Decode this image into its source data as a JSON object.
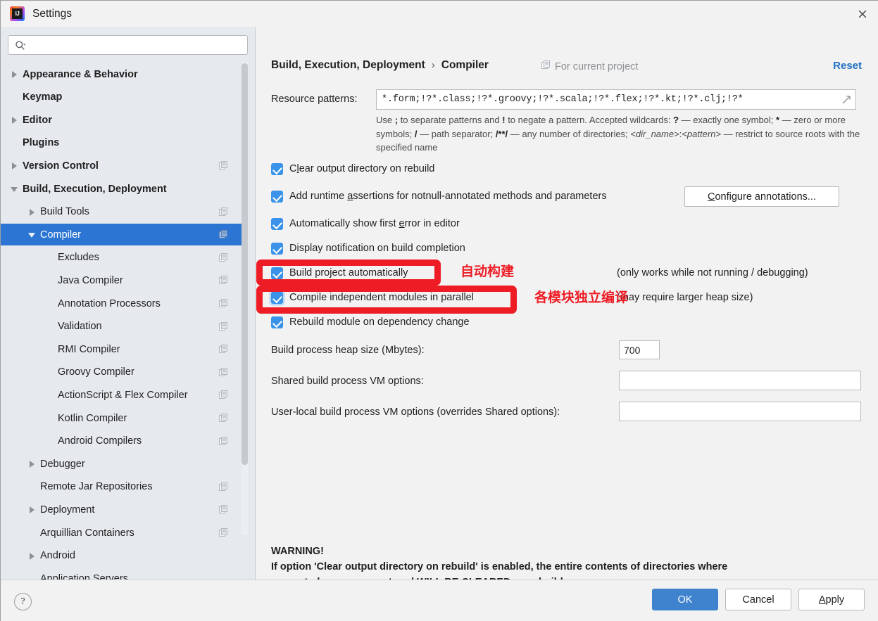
{
  "window": {
    "title": "Settings",
    "logo_icon": "intellij-idea-logo",
    "close_icon": "close-icon"
  },
  "sidebar": {
    "search": {
      "placeholder": "",
      "value": "",
      "icon": "search-icon"
    },
    "items": [
      {
        "label": "Appearance & Behavior",
        "indent": 0,
        "twisty": "closed",
        "bold": true,
        "project": false,
        "selected": false
      },
      {
        "label": "Keymap",
        "indent": 0,
        "twisty": "none",
        "bold": true,
        "project": false,
        "selected": false
      },
      {
        "label": "Editor",
        "indent": 0,
        "twisty": "closed",
        "bold": true,
        "project": false,
        "selected": false
      },
      {
        "label": "Plugins",
        "indent": 0,
        "twisty": "none",
        "bold": true,
        "project": false,
        "selected": false
      },
      {
        "label": "Version Control",
        "indent": 0,
        "twisty": "closed",
        "bold": true,
        "project": true,
        "selected": false
      },
      {
        "label": "Build, Execution, Deployment",
        "indent": 0,
        "twisty": "open",
        "bold": true,
        "project": false,
        "selected": false
      },
      {
        "label": "Build Tools",
        "indent": 1,
        "twisty": "closed",
        "bold": false,
        "project": true,
        "selected": false
      },
      {
        "label": "Compiler",
        "indent": 1,
        "twisty": "open",
        "bold": false,
        "project": true,
        "selected": true
      },
      {
        "label": "Excludes",
        "indent": 2,
        "twisty": "none",
        "bold": false,
        "project": true,
        "selected": false
      },
      {
        "label": "Java Compiler",
        "indent": 2,
        "twisty": "none",
        "bold": false,
        "project": true,
        "selected": false
      },
      {
        "label": "Annotation Processors",
        "indent": 2,
        "twisty": "none",
        "bold": false,
        "project": true,
        "selected": false
      },
      {
        "label": "Validation",
        "indent": 2,
        "twisty": "none",
        "bold": false,
        "project": true,
        "selected": false
      },
      {
        "label": "RMI Compiler",
        "indent": 2,
        "twisty": "none",
        "bold": false,
        "project": true,
        "selected": false
      },
      {
        "label": "Groovy Compiler",
        "indent": 2,
        "twisty": "none",
        "bold": false,
        "project": true,
        "selected": false
      },
      {
        "label": "ActionScript & Flex Compiler",
        "indent": 2,
        "twisty": "none",
        "bold": false,
        "project": true,
        "selected": false
      },
      {
        "label": "Kotlin Compiler",
        "indent": 2,
        "twisty": "none",
        "bold": false,
        "project": true,
        "selected": false
      },
      {
        "label": "Android Compilers",
        "indent": 2,
        "twisty": "none",
        "bold": false,
        "project": true,
        "selected": false
      },
      {
        "label": "Debugger",
        "indent": 1,
        "twisty": "closed",
        "bold": false,
        "project": false,
        "selected": false
      },
      {
        "label": "Remote Jar Repositories",
        "indent": 1,
        "twisty": "none",
        "bold": false,
        "project": true,
        "selected": false
      },
      {
        "label": "Deployment",
        "indent": 1,
        "twisty": "closed",
        "bold": false,
        "project": true,
        "selected": false
      },
      {
        "label": "Arquillian Containers",
        "indent": 1,
        "twisty": "none",
        "bold": false,
        "project": true,
        "selected": false
      },
      {
        "label": "Android",
        "indent": 1,
        "twisty": "closed",
        "bold": false,
        "project": false,
        "selected": false
      },
      {
        "label": "Application Servers",
        "indent": 1,
        "twisty": "none",
        "bold": false,
        "project": false,
        "selected": false
      }
    ]
  },
  "main": {
    "breadcrumb_root": "Build, Execution, Deployment",
    "breadcrumb_sep": "›",
    "breadcrumb_leaf": "Compiler",
    "for_current_project": "For current project",
    "for_current_project_icon": "project-scope-icon",
    "reset_label": "Reset",
    "resource_patterns": {
      "label": "Resource patterns:",
      "value": "*.form;!?*.class;!?*.groovy;!?*.scala;!?*.flex;!?*.kt;!?*.clj;!?*",
      "expand_icon": "expand-field-icon"
    },
    "resource_help": "Use ; to separate patterns and ! to negate a pattern. Accepted wildcards: ? — exactly one symbol; * — zero or more symbols; / — path separator; /**/ — any number of directories; <dir_name>:<pattern> — restrict to source roots with the specified name",
    "checkboxes": [
      {
        "label": "Clear output directory on rebuild",
        "checked": true,
        "mnemonic": "l"
      },
      {
        "label": "Add runtime assertions for notnull-annotated methods and parameters",
        "checked": true,
        "mnemonic": "a"
      },
      {
        "label": "Automatically show first error in editor",
        "checked": true,
        "mnemonic": "e"
      },
      {
        "label": "Display notification on build completion",
        "checked": true,
        "mnemonic": ""
      },
      {
        "label": "Build project automatically",
        "checked": true,
        "mnemonic": ""
      },
      {
        "label": "Compile independent modules in parallel",
        "checked": true,
        "mnemonic": ""
      },
      {
        "label": "Rebuild module on dependency change",
        "checked": true,
        "mnemonic": ""
      }
    ],
    "configure_annotations_button": "Configure annotations...",
    "note_build_auto": "(only works while not running / debugging)",
    "note_parallel": "(may require larger heap size)",
    "heap": {
      "label": "Build process heap size (Mbytes):",
      "value": "700"
    },
    "shared_vm": {
      "label": "Shared build process VM options:",
      "value": ""
    },
    "user_vm": {
      "label": "User-local build process VM options (overrides Shared options):",
      "value": ""
    },
    "warning_title": "WARNING!",
    "warning_line1": "If option 'Clear output directory on rebuild' is enabled, the entire contents of directories where",
    "warning_line2": "generated sources are stored WILL BE CLEARED on rebuild."
  },
  "annotations": [
    {
      "text": "自动构建",
      "color": "#ee1c25"
    },
    {
      "text": "各模块独立编译",
      "color": "#ee1c25"
    }
  ],
  "footer": {
    "help_label": "?",
    "ok_label": "OK",
    "cancel_label": "Cancel",
    "apply_label": "Apply",
    "apply_mnemonic": "A"
  },
  "colors": {
    "accent": "#2d75d2",
    "primary_button": "#3f82cd",
    "link": "#2470c4",
    "annotation_red": "#ee1c25",
    "checkbox": "#3a93e8",
    "sidebar_bg": "#e6eaee"
  }
}
